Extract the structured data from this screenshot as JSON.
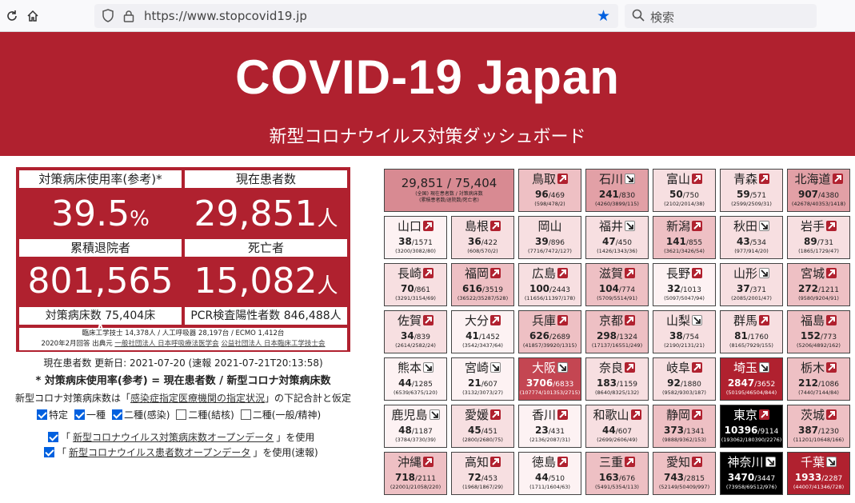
{
  "browser": {
    "url": "https://www.stopcovid19.jp",
    "search_placeholder": "検索"
  },
  "header": {
    "title": "COVID-19 Japan",
    "subtitle": "新型コロナウイルス対策ダッシュボード"
  },
  "stats": {
    "bed_rate_label": "対策病床使用率(参考)*",
    "bed_rate_value": "39.5",
    "bed_rate_unit": "%",
    "current_label": "現在患者数",
    "current_value": "29,851",
    "current_unit": "人",
    "discharged_label": "累積退院者",
    "discharged_value": "801,565",
    "discharged_unit": "人",
    "deaths_label": "死亡者",
    "deaths_value": "15,082",
    "deaths_unit": "人",
    "beds_foot": "対策病床数 75,404床",
    "pcr_foot": "PCR検査陽性者数 846,488人",
    "source_line1": "臨床工学技士 14,378人 / 人工呼吸器 28,197台 / ECMO 1,412台",
    "source_line2_prefix": "2020年2月回答 出典元",
    "source_link1": "一般社団法人 日本呼吸療法医学会",
    "source_link2": "公益社団法人 日本臨床工学技士会"
  },
  "updated": "現在患者数 更新日: 2021-07-20 (速報 2021-07-21T20:13:58)",
  "note_bold": "* 対策病床使用率(参考) = 現在患者数 / 新型コロナ対策病床数",
  "note_prefix": "新型コロナ対策病床数は「",
  "note_link": "感染症指定医療機関の指定状況",
  "note_suffix": "」の下記合計と仮定",
  "checkboxes": [
    {
      "label": "特定",
      "checked": true
    },
    {
      "label": "一種",
      "checked": true
    },
    {
      "label": "二種(感染)",
      "checked": true
    },
    {
      "label": "二種(結核)",
      "checked": false
    },
    {
      "label": "二種(一般/精神)",
      "checked": false
    }
  ],
  "options": [
    {
      "prefix": "「",
      "link": "新型コロナウイルス対策病床数オープンデータ",
      "suffix": "」を使用"
    },
    {
      "prefix": "「",
      "link": "新型コロナウイルス患者数オープンデータ",
      "suffix": "」を使用(速報)"
    }
  ],
  "summary_tile": {
    "value": "29,851 / 75,404",
    "sub1": "(全国) 現在患者数 / 対策病床数",
    "sub2": "(累積患者数/退院数/死亡者)"
  },
  "colors": {
    "brand": "#b0212f",
    "up_arrow": "#b0212f",
    "down_arrow": "#ffffff"
  },
  "prefectures": [
    {
      "name": "鳥取",
      "cur": "96",
      "beds": "469",
      "det": "(598/478/2)",
      "dir": "up",
      "level": 2
    },
    {
      "name": "石川",
      "cur": "241",
      "beds": "830",
      "det": "(4260/3899/115)",
      "dir": "down",
      "level": 3
    },
    {
      "name": "富山",
      "cur": "50",
      "beds": "750",
      "det": "(2102/2014/38)",
      "dir": "up",
      "level": 1
    },
    {
      "name": "青森",
      "cur": "59",
      "beds": "571",
      "det": "(2599/2509/31)",
      "dir": "up",
      "level": 1
    },
    {
      "name": "北海道",
      "cur": "907",
      "beds": "4380",
      "det": "(42678/40353/1418)",
      "dir": "up",
      "level": 3
    },
    {
      "name": "山口",
      "cur": "38",
      "beds": "1571",
      "det": "(3200/3082/80)",
      "dir": "up",
      "level": 0
    },
    {
      "name": "島根",
      "cur": "36",
      "beds": "422",
      "det": "(608/570/2)",
      "dir": "up",
      "level": 1
    },
    {
      "name": "岡山",
      "cur": "39",
      "beds": "896",
      "det": "(7716/7472/127)",
      "dir": "none",
      "level": 1
    },
    {
      "name": "福井",
      "cur": "47",
      "beds": "450",
      "det": "(1426/1343/36)",
      "dir": "down",
      "level": 1
    },
    {
      "name": "新潟",
      "cur": "141",
      "beds": "855",
      "det": "(3621/3426/54)",
      "dir": "up",
      "level": 2
    },
    {
      "name": "秋田",
      "cur": "43",
      "beds": "534",
      "det": "(977/914/20)",
      "dir": "down",
      "level": 1
    },
    {
      "name": "岩手",
      "cur": "89",
      "beds": "731",
      "det": "(1865/1729/47)",
      "dir": "up",
      "level": 1
    },
    {
      "name": "長崎",
      "cur": "70",
      "beds": "861",
      "det": "(3291/3154/69)",
      "dir": "up",
      "level": 1
    },
    {
      "name": "福岡",
      "cur": "616",
      "beds": "3519",
      "det": "(36522/35287/528)",
      "dir": "up",
      "level": 2
    },
    {
      "name": "広島",
      "cur": "100",
      "beds": "2443",
      "det": "(11656/11397/178)",
      "dir": "up",
      "level": 1
    },
    {
      "name": "滋賀",
      "cur": "104",
      "beds": "774",
      "det": "(5709/5514/91)",
      "dir": "up",
      "level": 2
    },
    {
      "name": "長野",
      "cur": "32",
      "beds": "1013",
      "det": "(5097/5047/94)",
      "dir": "up",
      "level": 0
    },
    {
      "name": "山形",
      "cur": "37",
      "beds": "371",
      "det": "(2085/2001/47)",
      "dir": "down",
      "level": 1
    },
    {
      "name": "宮城",
      "cur": "272",
      "beds": "1211",
      "det": "(9580/9204/91)",
      "dir": "up",
      "level": 2
    },
    {
      "name": "佐賀",
      "cur": "34",
      "beds": "839",
      "det": "(2614/2582/24)",
      "dir": "up",
      "level": 1
    },
    {
      "name": "大分",
      "cur": "41",
      "beds": "1452",
      "det": "(3542/3437/64)",
      "dir": "up",
      "level": 0
    },
    {
      "name": "兵庫",
      "cur": "626",
      "beds": "2689",
      "det": "(41857/39920/1315)",
      "dir": "up",
      "level": 2
    },
    {
      "name": "京都",
      "cur": "298",
      "beds": "1324",
      "det": "(17137/16551/249)",
      "dir": "up",
      "level": 2
    },
    {
      "name": "山梨",
      "cur": "38",
      "beds": "754",
      "det": "(2190/2131/21)",
      "dir": "down",
      "level": 1
    },
    {
      "name": "群馬",
      "cur": "81",
      "beds": "1760",
      "det": "(8165/7929/155)",
      "dir": "up",
      "level": 1
    },
    {
      "name": "福島",
      "cur": "152",
      "beds": "773",
      "det": "(5206/4892/162)",
      "dir": "up",
      "level": 2
    },
    {
      "name": "熊本",
      "cur": "44",
      "beds": "1285",
      "det": "(6539/6375/120)",
      "dir": "down",
      "level": 0
    },
    {
      "name": "宮崎",
      "cur": "21",
      "beds": "607",
      "det": "(3132/3073/27)",
      "dir": "down",
      "level": 0
    },
    {
      "name": "大阪",
      "cur": "3706",
      "beds": "6833",
      "det": "(107774/101353/2715)",
      "dir": "down",
      "level": 4
    },
    {
      "name": "奈良",
      "cur": "183",
      "beds": "1159",
      "det": "(8640/8325/132)",
      "dir": "up",
      "level": 1
    },
    {
      "name": "岐阜",
      "cur": "92",
      "beds": "1880",
      "det": "(9582/9303/187)",
      "dir": "up",
      "level": 1
    },
    {
      "name": "埼玉",
      "cur": "2847",
      "beds": "3652",
      "det": "(50195/46504/844)",
      "dir": "down",
      "level": 5
    },
    {
      "name": "栃木",
      "cur": "212",
      "beds": "1086",
      "det": "(7440/7144/84)",
      "dir": "up",
      "level": 2
    },
    {
      "name": "鹿児島",
      "cur": "48",
      "beds": "1187",
      "det": "(3784/3730/39)",
      "dir": "down",
      "level": 0
    },
    {
      "name": "愛媛",
      "cur": "45",
      "beds": "451",
      "det": "(2800/2680/75)",
      "dir": "up",
      "level": 1
    },
    {
      "name": "香川",
      "cur": "23",
      "beds": "431",
      "det": "(2136/2087/31)",
      "dir": "up",
      "level": 0
    },
    {
      "name": "和歌山",
      "cur": "44",
      "beds": "607",
      "det": "(2699/2606/49)",
      "dir": "up",
      "level": 1
    },
    {
      "name": "静岡",
      "cur": "373",
      "beds": "1341",
      "det": "(9888/9362/153)",
      "dir": "up",
      "level": 2
    },
    {
      "name": "東京",
      "cur": "10396",
      "beds": "9114",
      "det": "(193062/180390/2276)",
      "dir": "up",
      "level": 6
    },
    {
      "name": "茨城",
      "cur": "387",
      "beds": "1230",
      "det": "(11201/10648/166)",
      "dir": "up",
      "level": 2
    },
    {
      "name": "沖縄",
      "cur": "718",
      "beds": "2111",
      "det": "(22001/21058/220)",
      "dir": "up",
      "level": 2
    },
    {
      "name": "高知",
      "cur": "72",
      "beds": "453",
      "det": "(1968/1867/29)",
      "dir": "up",
      "level": 1
    },
    {
      "name": "徳島",
      "cur": "44",
      "beds": "510",
      "det": "(1711/1604/63)",
      "dir": "up",
      "level": 0
    },
    {
      "name": "三重",
      "cur": "163",
      "beds": "676",
      "det": "(5491/5354/113)",
      "dir": "up",
      "level": 2
    },
    {
      "name": "愛知",
      "cur": "743",
      "beds": "2815",
      "det": "(52149/50409/997)",
      "dir": "up",
      "level": 2
    },
    {
      "name": "神奈川",
      "cur": "3470",
      "beds": "3447",
      "det": "(73958/69512/976)",
      "dir": "down",
      "level": 6
    },
    {
      "name": "千葉",
      "cur": "1933",
      "beds": "2287",
      "det": "(44007/41346/728)",
      "dir": "down",
      "level": 5
    }
  ]
}
